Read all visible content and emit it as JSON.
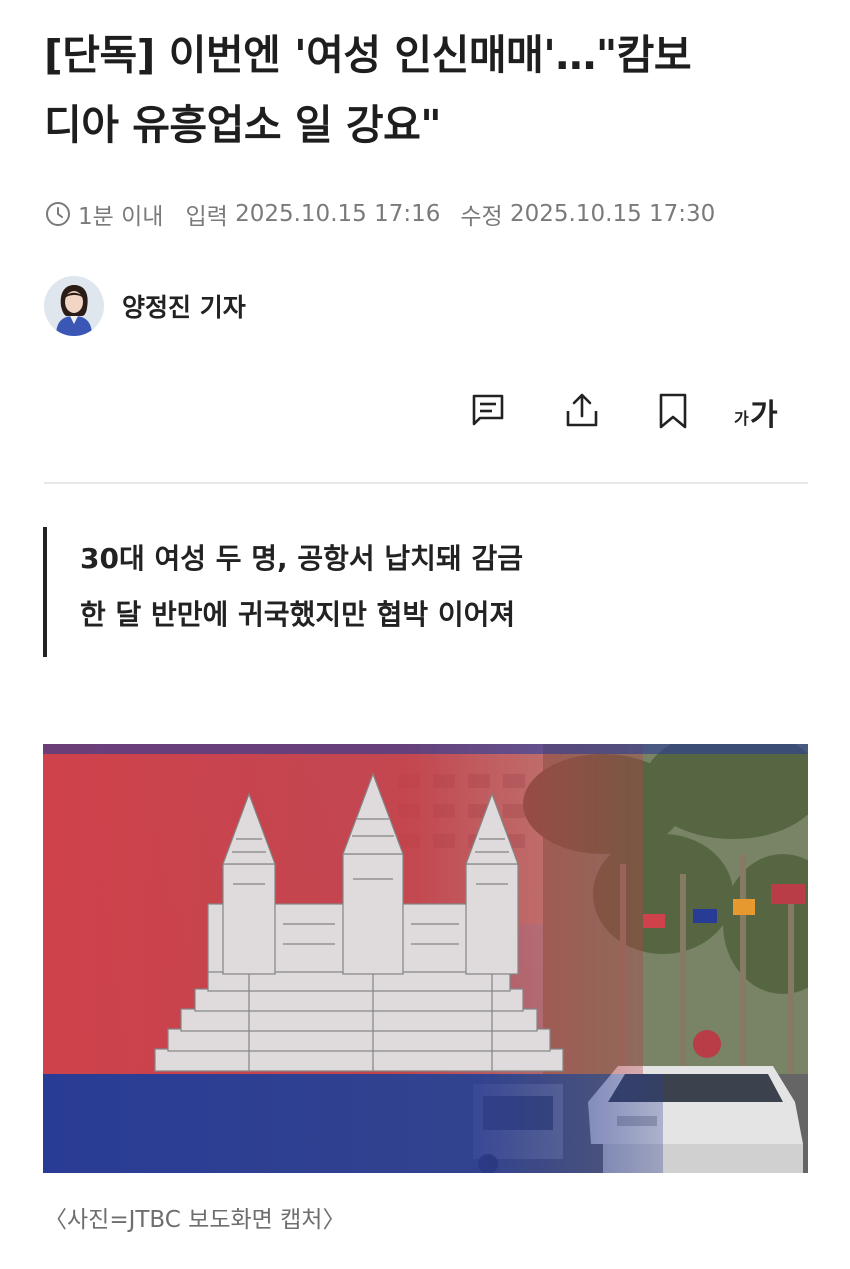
{
  "article": {
    "title_line1": "[단독] 이번엔 '여성 인신매매'…\"캄보",
    "title_line2": "디아 유흥업소 일 강요\"",
    "read_time": "1분 이내",
    "published_label": "입력",
    "published": "2025.10.15 17:16",
    "updated_label": "수정",
    "updated": "2025.10.15 17:30",
    "author": "양정진 기자",
    "summary": [
      "30대 여성 두 명, 공항서 납치돼 감금",
      "한 달 반만에 귀국했지만 협박 이어져"
    ],
    "photo_caption": "〈사진=JTBC 보도화면 캡처〉"
  },
  "toolbar": {
    "icons": [
      "comment-icon",
      "share-icon",
      "bookmark-icon",
      "font-size-icon"
    ],
    "font_small": "가",
    "font_large": "가"
  },
  "colors": {
    "flag_red": "#d8454f",
    "flag_blue": "#2b3f9c",
    "text": "#1e1e1e",
    "meta": "#7a7a7a"
  }
}
